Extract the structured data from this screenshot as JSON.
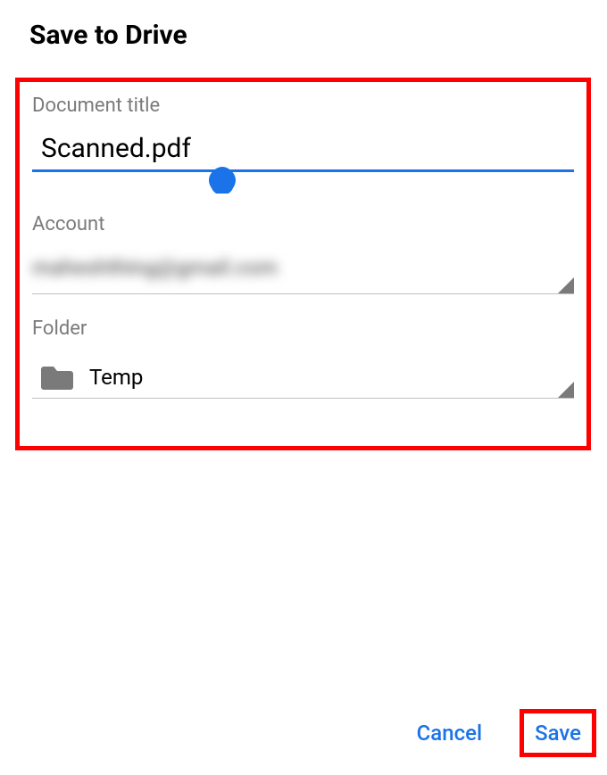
{
  "header": {
    "title": "Save to Drive"
  },
  "form": {
    "document_title_label": "Document title",
    "document_title_value": "Scanned.pdf",
    "account_label": "Account",
    "account_value": "maheshthing@gmail.com",
    "folder_label": "Folder",
    "folder_value": "Temp"
  },
  "buttons": {
    "cancel_label": "Cancel",
    "save_label": "Save"
  },
  "colors": {
    "accent": "#1a73e8",
    "highlight_border": "#ff0000",
    "label_grey": "#7a7a7a"
  }
}
